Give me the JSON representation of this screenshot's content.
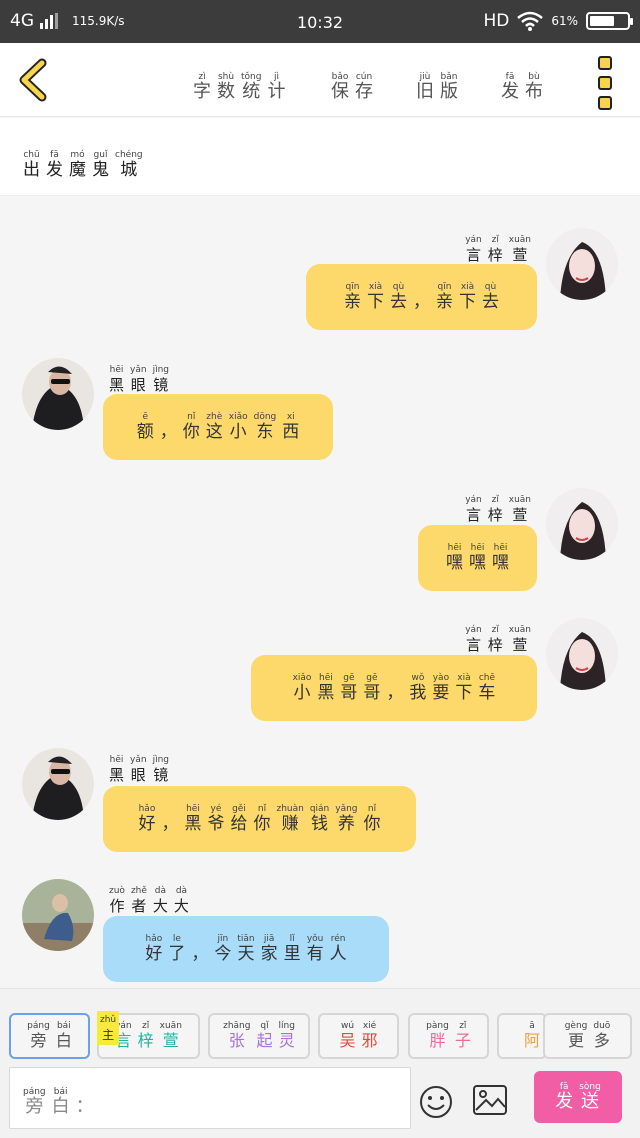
{
  "status_bar": {
    "network": "4G",
    "speed": "115.9K/s",
    "time": "10:32",
    "hd": "HD",
    "battery": "61%",
    "battery_level": 0.61
  },
  "header": {
    "tabs": [
      {
        "pinyin": [
          "zì",
          "shù",
          "tǒng",
          "jì"
        ],
        "chars": [
          "字",
          "数",
          "统",
          "计"
        ]
      },
      {
        "pinyin": [
          "bǎo",
          "cún"
        ],
        "chars": [
          "保",
          "存"
        ]
      },
      {
        "pinyin": [
          "jiù",
          "bǎn"
        ],
        "chars": [
          "旧",
          "版"
        ]
      },
      {
        "pinyin": [
          "fā",
          "bù"
        ],
        "chars": [
          "发",
          "布"
        ]
      }
    ]
  },
  "title": {
    "pinyin": [
      "chū",
      "fā",
      "mó",
      "guǐ",
      "chéng"
    ],
    "chars": [
      "出",
      "发",
      "魔",
      "鬼",
      "城"
    ]
  },
  "messages": [
    {
      "side": "right",
      "color": "yellow",
      "name": {
        "pinyin": [
          "yán",
          "zǐ",
          "xuān"
        ],
        "chars": [
          "言",
          "梓",
          "萱"
        ]
      },
      "text": {
        "pinyin": [
          "qīn",
          "xià",
          "qù",
          "",
          "qīn",
          "xià",
          "qù"
        ],
        "chars": [
          "亲",
          "下",
          "去",
          "，",
          "亲",
          "下",
          "去"
        ]
      }
    },
    {
      "side": "left",
      "color": "yellow",
      "name": {
        "pinyin": [
          "hēi",
          "yǎn",
          "jìng"
        ],
        "chars": [
          "黑",
          "眼",
          "镜"
        ]
      },
      "text": {
        "pinyin": [
          "ē",
          "",
          "nǐ",
          "zhè",
          "xiǎo",
          "dōng",
          "xi"
        ],
        "chars": [
          "额",
          "，",
          "你",
          "这",
          "小",
          "东",
          "西"
        ]
      }
    },
    {
      "side": "right",
      "color": "yellow",
      "name": {
        "pinyin": [
          "yán",
          "zǐ",
          "xuān"
        ],
        "chars": [
          "言",
          "梓",
          "萱"
        ]
      },
      "text": {
        "pinyin": [
          "hēi",
          "hēi",
          "hēi"
        ],
        "chars": [
          "嘿",
          "嘿",
          "嘿"
        ]
      }
    },
    {
      "side": "right",
      "color": "yellow",
      "name": {
        "pinyin": [
          "yán",
          "zǐ",
          "xuān"
        ],
        "chars": [
          "言",
          "梓",
          "萱"
        ]
      },
      "text": {
        "pinyin": [
          "xiǎo",
          "hēi",
          "gē",
          "gē",
          "",
          "wǒ",
          "yào",
          "xià",
          "chē"
        ],
        "chars": [
          "小",
          "黑",
          "哥",
          "哥",
          "，",
          "我",
          "要",
          "下",
          "车"
        ]
      }
    },
    {
      "side": "left",
      "color": "yellow",
      "name": {
        "pinyin": [
          "hēi",
          "yǎn",
          "jìng"
        ],
        "chars": [
          "黑",
          "眼",
          "镜"
        ]
      },
      "text": {
        "pinyin": [
          "hǎo",
          "",
          "hēi",
          "yé",
          "gěi",
          "nǐ",
          "zhuàn",
          "qián",
          "yǎng",
          "nǐ"
        ],
        "chars": [
          "好",
          "，",
          "黑",
          "爷",
          "给",
          "你",
          "赚",
          "钱",
          "养",
          "你"
        ]
      }
    },
    {
      "side": "left",
      "color": "blue",
      "name": {
        "pinyin": [
          "zuò",
          "zhě",
          "dà",
          "dà"
        ],
        "chars": [
          "作",
          "者",
          "大",
          "大"
        ]
      },
      "text": {
        "pinyin": [
          "hǎo",
          "le",
          "",
          "jīn",
          "tiān",
          "jiā",
          "lǐ",
          "yǒu",
          "rén"
        ],
        "chars": [
          "好",
          "了",
          "，",
          "今",
          "天",
          "家",
          "里",
          "有",
          "人"
        ]
      }
    }
  ],
  "roles": [
    {
      "pinyin": [
        "páng",
        "bái"
      ],
      "chars": [
        "旁",
        "白"
      ],
      "color": "#555555",
      "active": true
    },
    {
      "pinyin": [
        "yán",
        "zǐ",
        "xuān"
      ],
      "chars": [
        "言",
        "梓",
        "萱"
      ],
      "color": "#1fb3a2",
      "badge": {
        "pinyin": "zhǔ",
        "char": "主"
      }
    },
    {
      "pinyin": [
        "zhāng",
        "qǐ",
        "líng"
      ],
      "chars": [
        "张",
        "起",
        "灵"
      ],
      "color": "#a873d6"
    },
    {
      "pinyin": [
        "wú",
        "xié"
      ],
      "chars": [
        "吴",
        "邪"
      ],
      "color": "#e2473a"
    },
    {
      "pinyin": [
        "pàng",
        "zǐ"
      ],
      "chars": [
        "胖",
        "子"
      ],
      "color": "#ee6b9c"
    },
    {
      "pinyin": [
        "ā"
      ],
      "chars": [
        "阿"
      ],
      "color": "#f0a040"
    },
    {
      "pinyin": [
        "gèng",
        "duō"
      ],
      "chars": [
        "更",
        "多"
      ],
      "color": "#555555"
    }
  ],
  "input": {
    "pinyin": [
      "páng",
      "bái",
      ""
    ],
    "chars": [
      "旁",
      "白",
      "："
    ]
  },
  "send": {
    "pinyin": [
      "fā",
      "sòng"
    ],
    "chars": [
      "发",
      "送"
    ]
  },
  "icons": {
    "back": "back-arrow-icon",
    "menu": "menu-icon",
    "emoji": "emoji-icon",
    "picture": "picture-icon"
  }
}
